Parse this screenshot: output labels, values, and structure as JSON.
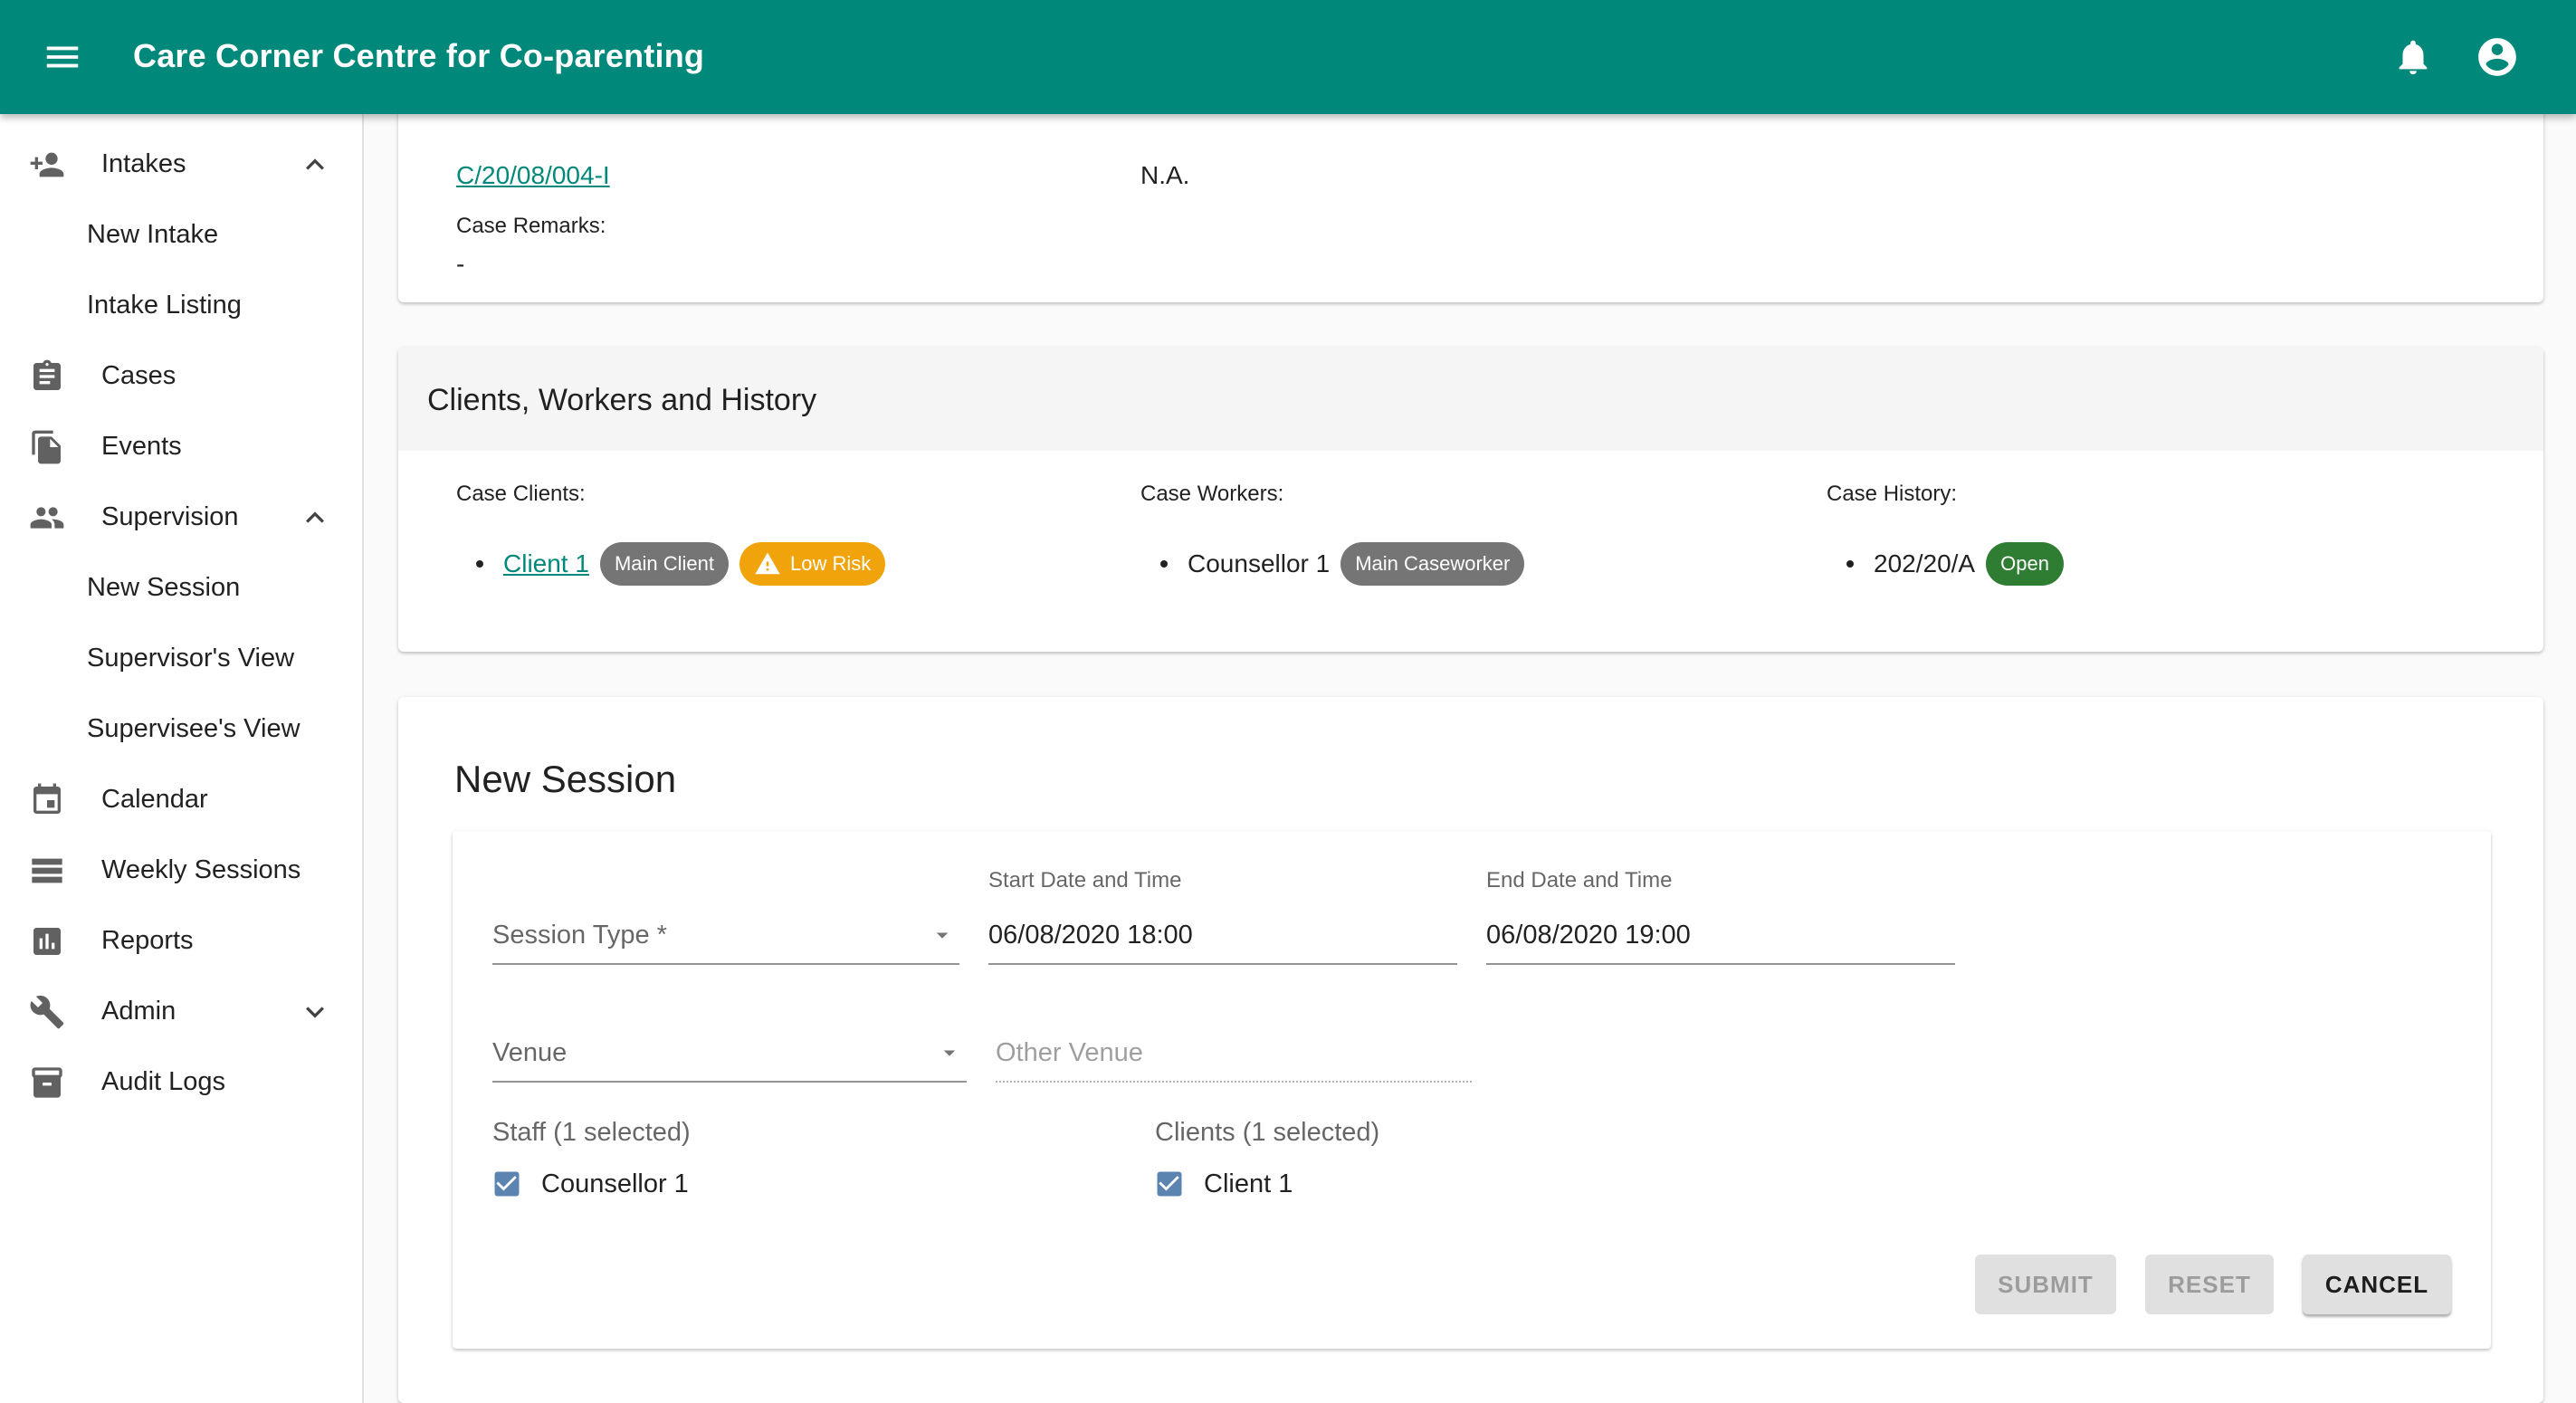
{
  "app": {
    "title": "Care Corner Centre for Co-parenting",
    "brand_color": "#00897b",
    "icons": {
      "menu": "menu-icon",
      "notifications": "bell-icon",
      "account": "account-circle-icon"
    }
  },
  "sidebar": {
    "items": [
      {
        "label": "Intakes",
        "icon": "person-add-icon",
        "expanded": true
      },
      {
        "label": "New Intake",
        "sub": true
      },
      {
        "label": "Intake Listing",
        "sub": true
      },
      {
        "label": "Cases",
        "icon": "clipboard-icon"
      },
      {
        "label": "Events",
        "icon": "file-copy-icon"
      },
      {
        "label": "Supervision",
        "icon": "people-icon",
        "expanded": true
      },
      {
        "label": "New Session",
        "sub": true
      },
      {
        "label": "Supervisor's View",
        "sub": true
      },
      {
        "label": "Supervisee's View",
        "sub": true
      },
      {
        "label": "Calendar",
        "icon": "calendar-icon"
      },
      {
        "label": "Weekly Sessions",
        "icon": "view-list-icon"
      },
      {
        "label": "Reports",
        "icon": "bar-chart-icon"
      },
      {
        "label": "Admin",
        "icon": "wrench-icon",
        "expanded": false
      },
      {
        "label": "Audit Logs",
        "icon": "archive-icon"
      }
    ]
  },
  "case_info": {
    "case_link": "C/20/08/004-I",
    "second_value": "N.A.",
    "remarks_label": "Case Remarks:",
    "remarks_value": "-"
  },
  "clients_card": {
    "title": "Clients, Workers and History",
    "clients": {
      "heading": "Case Clients:",
      "items": [
        {
          "name": "Client 1",
          "chips": [
            "Main Client",
            "Low Risk"
          ]
        }
      ]
    },
    "workers": {
      "heading": "Case Workers:",
      "items": [
        {
          "name": "Counsellor 1",
          "chips": [
            "Main Caseworker"
          ]
        }
      ]
    },
    "history": {
      "heading": "Case History:",
      "items": [
        {
          "name": "202/20/A",
          "chips": [
            "Open"
          ]
        }
      ]
    },
    "chip_colors": {
      "grey": "#757575",
      "risk": "#f0a30a",
      "open": "#2e7d32"
    }
  },
  "new_session": {
    "title": "New Session",
    "session_type": {
      "placeholder": "Session Type *"
    },
    "start": {
      "label": "Start Date and Time",
      "value": "06/08/2020 18:00"
    },
    "end": {
      "label": "End Date and Time",
      "value": "06/08/2020 19:00"
    },
    "venue": {
      "placeholder": "Venue"
    },
    "other_venue": {
      "placeholder": "Other Venue"
    },
    "staff": {
      "label": "Staff (1 selected)",
      "options": [
        {
          "label": "Counsellor 1",
          "checked": true
        }
      ]
    },
    "clients": {
      "label": "Clients (1 selected)",
      "options": [
        {
          "label": "Client 1",
          "checked": true
        }
      ]
    },
    "buttons": {
      "submit": "SUBMIT",
      "reset": "RESET",
      "cancel": "CANCEL"
    }
  }
}
